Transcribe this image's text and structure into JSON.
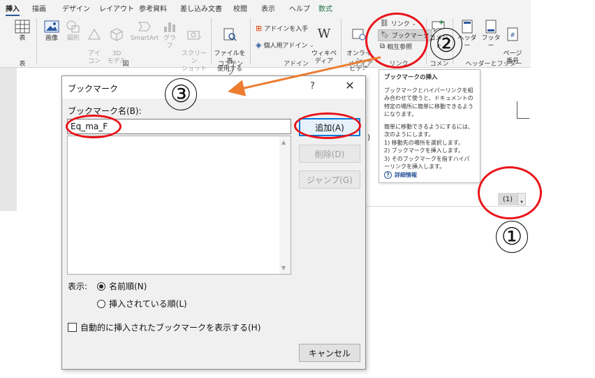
{
  "ribbon": {
    "tabs": [
      "挿入",
      "描画",
      "デザイン",
      "レイアウト",
      "参考資料",
      "差し込み文書",
      "校閲",
      "表示",
      "ヘルプ",
      "数式"
    ],
    "buttons": {
      "table": "表",
      "image": "画像",
      "shape": "図形",
      "icon": "アイ\nコン",
      "model3d": "3D\nモデル",
      "smartart": "SmartArt",
      "graph": "グラフ",
      "screenshot": "スクリーン\nショット",
      "file_reuse": "ファイルを再\n使用する",
      "add_in_get": "アドインを入手",
      "personal_add_in": "個人用アドイン",
      "wikipedia": "ウィキペ\nディア",
      "online_video": "オンライン\nビデオ",
      "link": "リンク",
      "bookmark": "ブックマーク",
      "cross_ref": "相互参照",
      "comment": "コメント",
      "header": "ヘッダー",
      "footer": "フッター",
      "page_number": "ページ\n番号"
    },
    "groups": {
      "table": "表",
      "illustrations": "図",
      "content": "コンテンツ",
      "addins": "アドイン",
      "media": "メディア",
      "links": "リンク",
      "comments": "コメント",
      "header_footer": "ヘッダーとフッター"
    }
  },
  "tooltip": {
    "title": "ブックマークの挿入",
    "desc1": "ブックマークとハイパーリンクを組み合わせて使うと、ドキュメントの特定の場所に簡単に移動できるようになります。",
    "desc2": "簡単に移動できるようにするには、次のようにします。",
    "step1": "1) 移動先の場所を選択します。",
    "step2": "2) ブックマークを挿入します。",
    "step3": "3) そのブックマークを指すハイパーリンクを挿入します。",
    "more": "詳細情報"
  },
  "document": {
    "equation_number": "(1)",
    "fragment_paren": ")"
  },
  "dialog": {
    "title": "ブックマーク",
    "help": "?",
    "close": "✕",
    "name_label": "ブックマーク名(B):",
    "name_value": "Eq_ma_F",
    "add": "追加(A)",
    "delete": "削除(D)",
    "jump": "ジャンプ(G)",
    "sort_label": "表示:",
    "sort_by_name": "名前順(N)",
    "sort_by_location": "挿入されている順(L)",
    "show_hidden": "自動的に挿入されたブックマークを表示する(H)",
    "cancel": "キャンセル"
  },
  "annotations": {
    "step1": "①",
    "step2": "②",
    "step3": "③",
    "color": "#e8141a",
    "arrow_color": "#ed7d31"
  }
}
